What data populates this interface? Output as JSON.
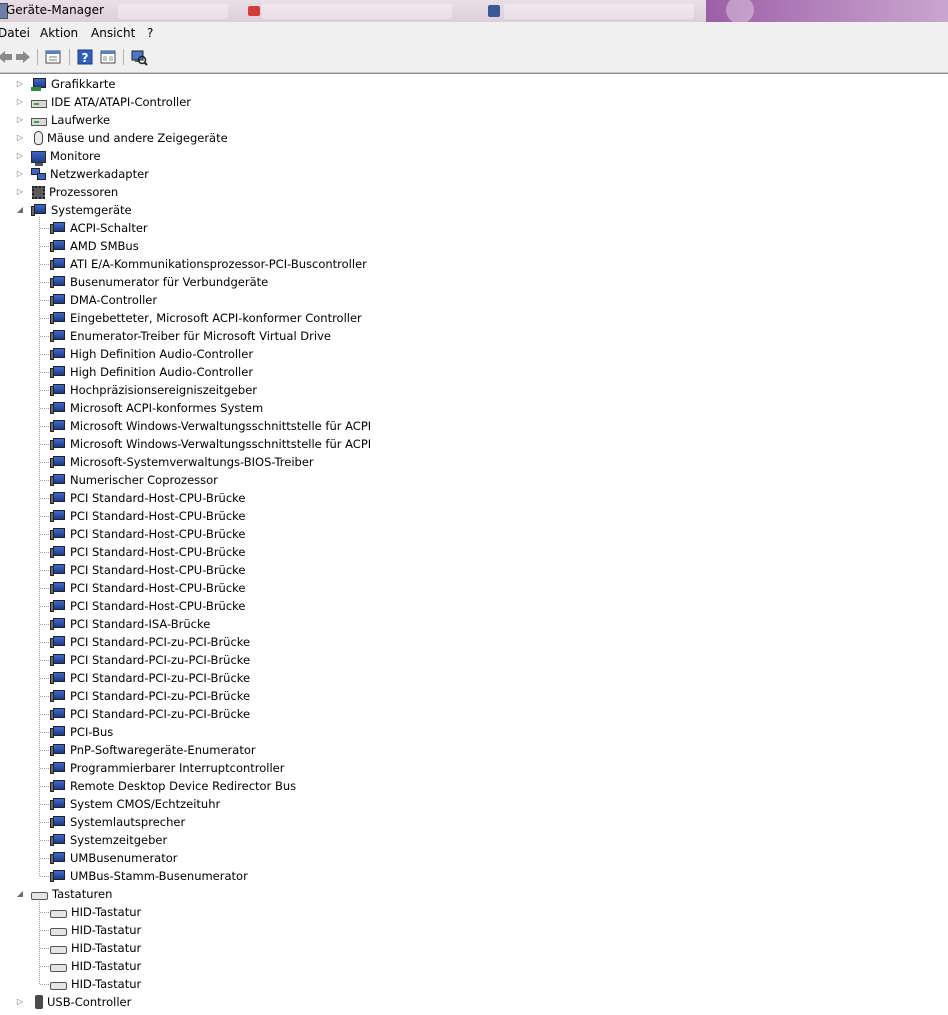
{
  "window": {
    "title": "Geräte-Manager"
  },
  "menu": [
    "Datei",
    "Aktion",
    "Ansicht",
    "?"
  ],
  "toolbar": {
    "buttons": [
      "back-arrow-icon",
      "forward-arrow-icon",
      "properties-icon",
      "help-icon",
      "details-view-icon",
      "scan-hardware-icon"
    ]
  },
  "tree": {
    "categories": [
      {
        "label": "Grafikkarte",
        "icon": "display-adapter-icon",
        "expanded": false
      },
      {
        "label": "IDE ATA/ATAPI-Controller",
        "icon": "ide-controller-icon",
        "expanded": false
      },
      {
        "label": "Laufwerke",
        "icon": "disk-drive-icon",
        "expanded": false
      },
      {
        "label": "Mäuse und andere Zeigegeräte",
        "icon": "mouse-icon",
        "expanded": false
      },
      {
        "label": "Monitore",
        "icon": "monitor-icon",
        "expanded": false
      },
      {
        "label": "Netzwerkadapter",
        "icon": "network-adapter-icon",
        "expanded": false
      },
      {
        "label": "Prozessoren",
        "icon": "processor-icon",
        "expanded": false
      },
      {
        "label": "Systemgeräte",
        "icon": "system-device-icon",
        "expanded": true,
        "children": [
          "ACPI-Schalter",
          "AMD SMBus",
          "ATI E/A-Kommunikationsprozessor-PCI-Buscontroller",
          "Busenumerator für Verbundgeräte",
          "DMA-Controller",
          "Eingebetteter, Microsoft ACPI-konformer Controller",
          "Enumerator-Treiber für Microsoft Virtual Drive",
          "High Definition Audio-Controller",
          "High Definition Audio-Controller",
          "Hochpräzisionsereigniszeitgeber",
          "Microsoft ACPI-konformes System",
          "Microsoft Windows-Verwaltungsschnittstelle für ACPI",
          "Microsoft Windows-Verwaltungsschnittstelle für ACPI",
          "Microsoft-Systemverwaltungs-BIOS-Treiber",
          "Numerischer Coprozessor",
          "PCI Standard-Host-CPU-Brücke",
          "PCI Standard-Host-CPU-Brücke",
          "PCI Standard-Host-CPU-Brücke",
          "PCI Standard-Host-CPU-Brücke",
          "PCI Standard-Host-CPU-Brücke",
          "PCI Standard-Host-CPU-Brücke",
          "PCI Standard-Host-CPU-Brücke",
          "PCI Standard-ISA-Brücke",
          "PCI Standard-PCI-zu-PCI-Brücke",
          "PCI Standard-PCI-zu-PCI-Brücke",
          "PCI Standard-PCI-zu-PCI-Brücke",
          "PCI Standard-PCI-zu-PCI-Brücke",
          "PCI Standard-PCI-zu-PCI-Brücke",
          "PCI-Bus",
          "PnP-Softwaregeräte-Enumerator",
          "Programmierbarer Interruptcontroller",
          "Remote Desktop Device Redirector Bus",
          "System CMOS/Echtzeituhr",
          "Systemlautsprecher",
          "Systemzeitgeber",
          "UMBusenumerator",
          "UMBus-Stamm-Busenumerator"
        ]
      },
      {
        "label": "Tastaturen",
        "icon": "keyboard-icon",
        "expanded": true,
        "children": [
          "HID-Tastatur",
          "HID-Tastatur",
          "HID-Tastatur",
          "HID-Tastatur",
          "HID-Tastatur"
        ]
      },
      {
        "label": "USB-Controller",
        "icon": "usb-icon",
        "expanded": false
      }
    ]
  }
}
